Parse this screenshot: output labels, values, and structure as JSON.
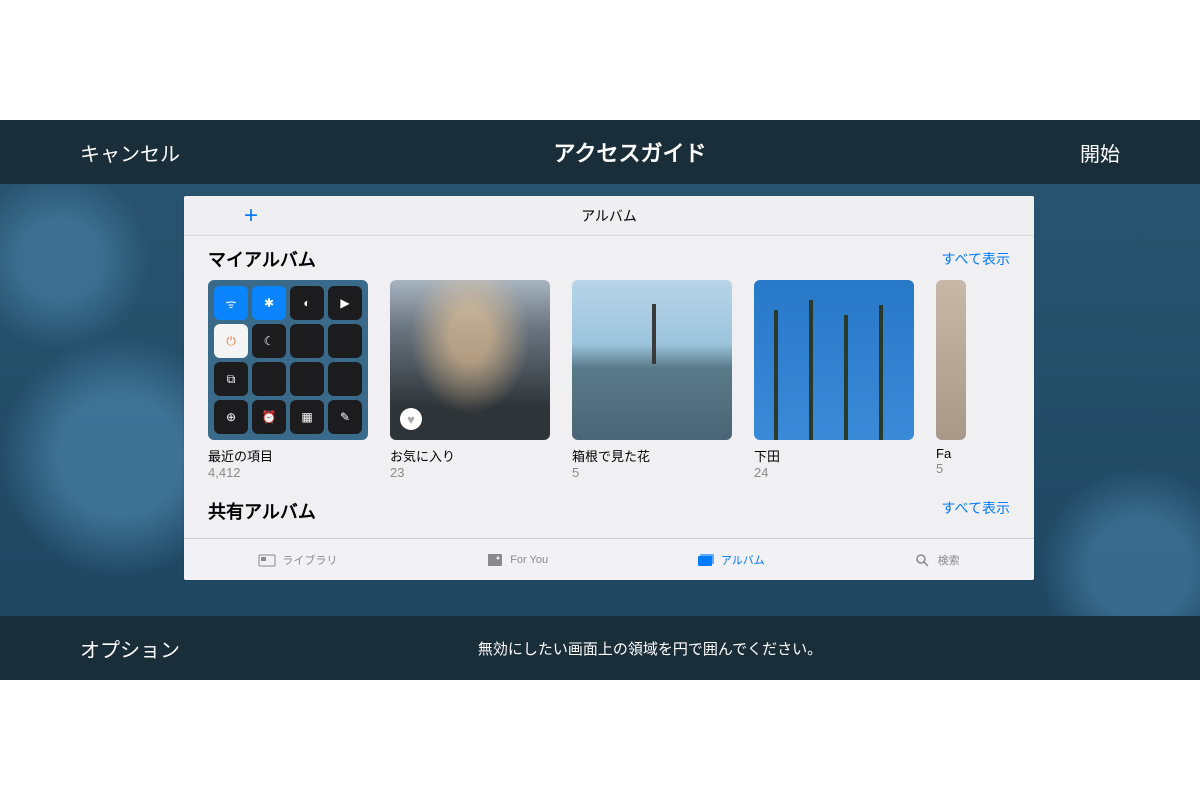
{
  "guided_access": {
    "cancel": "キャンセル",
    "title": "アクセスガイド",
    "start": "開始",
    "options": "オプション",
    "hint": "無効にしたい画面上の領域を円で囲んでください。"
  },
  "photos": {
    "header_title": "アルバム",
    "section1": {
      "title": "マイアルバム",
      "show_all": "すべて表示"
    },
    "albums": [
      {
        "name": "最近の項目",
        "count": "4,412"
      },
      {
        "name": "お気に入り",
        "count": "23"
      },
      {
        "name": "箱根で見た花",
        "count": "5"
      },
      {
        "name": "下田",
        "count": "24"
      },
      {
        "name": "Fa",
        "count": "5"
      }
    ],
    "section2": {
      "title": "共有アルバム",
      "show_all": "すべて表示"
    },
    "tabs": [
      {
        "label": "ライブラリ",
        "active": false
      },
      {
        "label": "For You",
        "active": false
      },
      {
        "label": "アルバム",
        "active": true
      },
      {
        "label": "検索",
        "active": false
      }
    ]
  }
}
